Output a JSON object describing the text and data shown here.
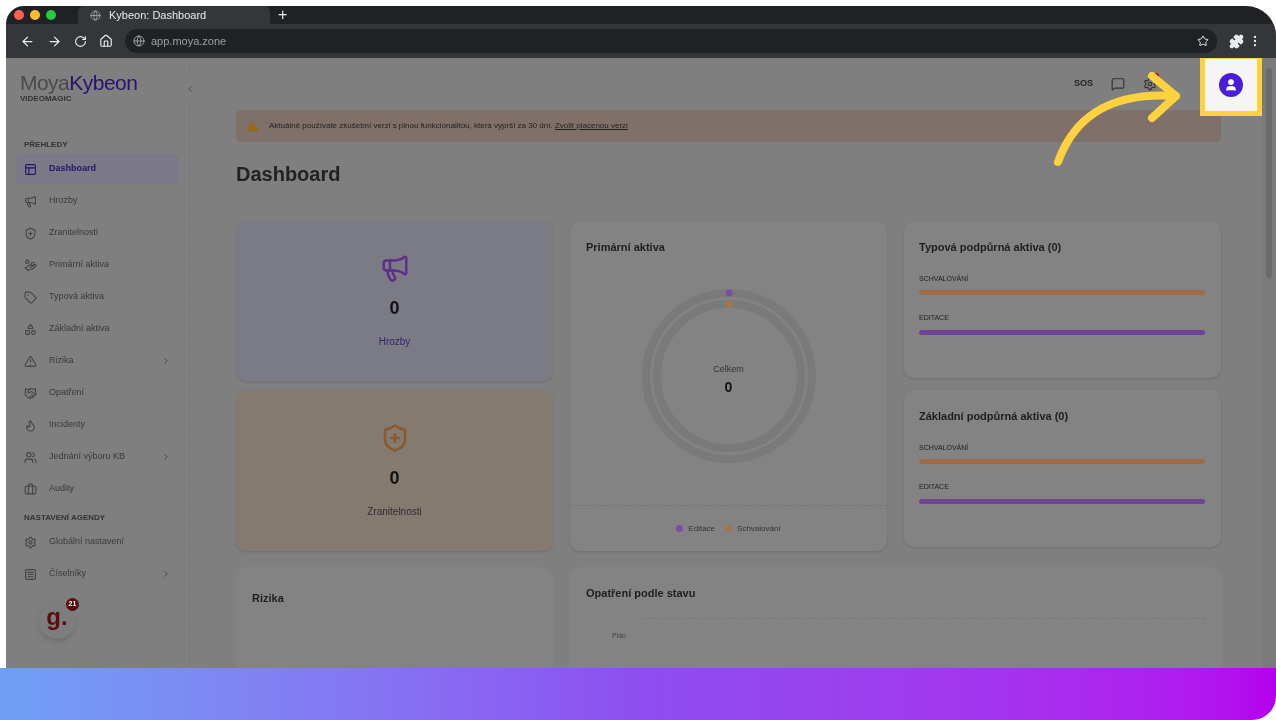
{
  "browser": {
    "tab_title": "Kybeon: Dashboard",
    "new_tab": "+",
    "url": "app.moya.zone"
  },
  "logo": {
    "part_1": "Moya",
    "part_2": "Kybeon",
    "subtitle": "VIDEOMAGIC"
  },
  "sidebar": {
    "sections": [
      {
        "title": "PŘEHLEDY",
        "items": [
          {
            "label": "Dashboard",
            "selected": true,
            "has_children": false
          },
          {
            "label": "Hrozby",
            "selected": false,
            "has_children": false
          },
          {
            "label": "Zranitelnosti",
            "selected": false,
            "has_children": false
          },
          {
            "label": "Primární aktiva",
            "selected": false,
            "has_children": false
          },
          {
            "label": "Typová aktiva",
            "selected": false,
            "has_children": false
          },
          {
            "label": "Základní aktiva",
            "selected": false,
            "has_children": false
          },
          {
            "label": "Rizika",
            "selected": false,
            "has_children": true
          },
          {
            "label": "Opatření",
            "selected": false,
            "has_children": false
          },
          {
            "label": "Incidenty",
            "selected": false,
            "has_children": false
          },
          {
            "label": "Jednání výboru KB",
            "selected": false,
            "has_children": true
          },
          {
            "label": "Audity",
            "selected": false,
            "has_children": false
          }
        ]
      },
      {
        "title": "NASTAVENÍ AGENDY",
        "items": [
          {
            "label": "Globální nastavení",
            "selected": false,
            "has_children": false
          },
          {
            "label": "Číselníky",
            "selected": false,
            "has_children": true
          }
        ]
      }
    ],
    "widget": {
      "letter": "g.",
      "badge": "21"
    }
  },
  "header": {
    "sos": "SOS",
    "notification": true
  },
  "alert": {
    "text": "Aktuálně používate zkušební verzi s plnou funkcionalitou, která vyprší za 30 dní.",
    "link": "Zvolit placenou verzi"
  },
  "title": "Dashboard",
  "stat_cards": [
    {
      "kind": "threat",
      "value": "0",
      "label": "Hrozby"
    },
    {
      "kind": "vulnerability",
      "value": "0",
      "label": "Zranitelnosti"
    }
  ],
  "primary_assets": {
    "title": "Primární aktiva",
    "center_label": "Celkem",
    "center_value": "0",
    "legend": [
      {
        "label": "Editace",
        "color": "#7e4ca8"
      },
      {
        "label": "Schvalování",
        "color": "#a8744a"
      }
    ]
  },
  "bar_cards": [
    {
      "title": "Typová podpůrná aktiva (0)",
      "bars": [
        {
          "label": "SCHVALOVÁNÍ",
          "color": "#a06c45"
        },
        {
          "label": "EDITACE",
          "color": "#6f4496"
        }
      ]
    },
    {
      "title": "Základní podpůrná aktiva (0)",
      "bars": [
        {
          "label": "SCHVALOVÁNÍ",
          "color": "#a06c45"
        },
        {
          "label": "EDITACE",
          "color": "#6f4496"
        }
      ]
    }
  ],
  "bottom_cards": [
    {
      "title": "Rizika"
    },
    {
      "title": "Opatření podle stavu",
      "axis_label": "Plán"
    }
  ]
}
